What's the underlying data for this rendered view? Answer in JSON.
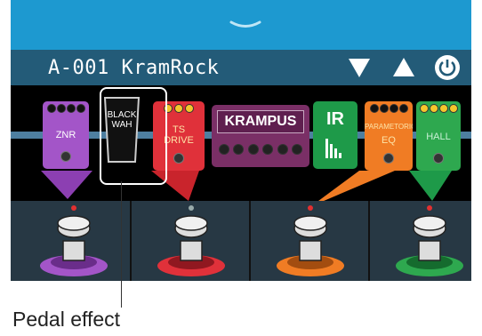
{
  "topbar": {
    "collapse_icon": "chevron-down-icon"
  },
  "header": {
    "patch_name": "A-001 KramRock",
    "buttons": [
      "patch-down-icon",
      "patch-up-icon",
      "power-icon"
    ]
  },
  "pedals": [
    {
      "name": "ZNR",
      "color": "#a355c8"
    },
    {
      "name": "BLACK WAH",
      "lines": [
        "BLACK",
        "WAH"
      ],
      "color": "#111111"
    },
    {
      "name": "TS DRIVE",
      "lines": [
        "TS",
        "DRIVE"
      ],
      "color": "#e0313a"
    },
    {
      "name": "KRAMPUS",
      "color": "#7a2f66"
    },
    {
      "name": "IR",
      "color": "#1e9a49"
    },
    {
      "name": "PARAMETORIC EQ",
      "lines": [
        "PARAMETORIC",
        "EQ"
      ],
      "color": "#f07c24"
    },
    {
      "name": "HALL",
      "color": "#2ea84f"
    }
  ],
  "footswitches": [
    {
      "ring_color": "#a355c8",
      "indicator": "red"
    },
    {
      "ring_color": "#e0313a",
      "indicator": "gray"
    },
    {
      "ring_color": "#f07c24",
      "indicator": "red"
    },
    {
      "ring_color": "#2ea84f",
      "indicator": "red"
    }
  ],
  "callout": {
    "label": "Pedal effect"
  }
}
